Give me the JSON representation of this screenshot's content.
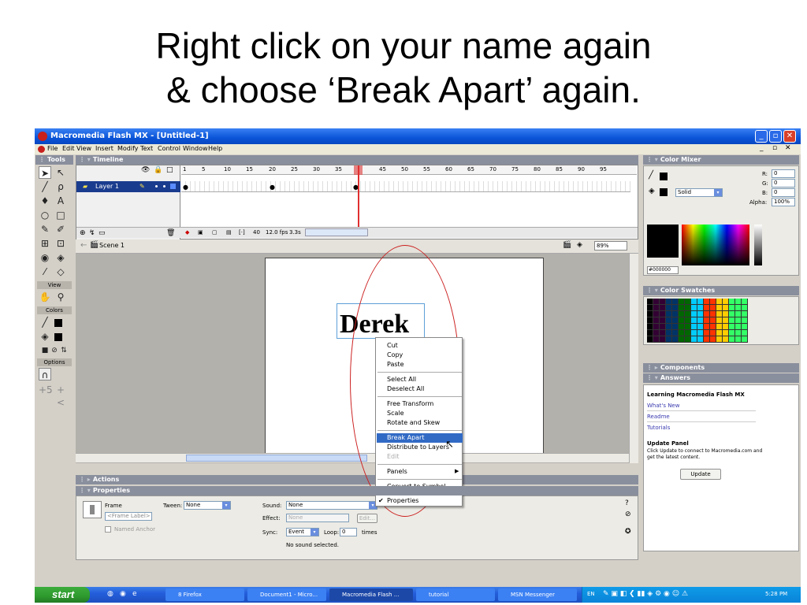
{
  "slide": {
    "title_line1": "Right click on your name again",
    "title_line2": "& choose ‘Break Apart’ again."
  },
  "window": {
    "title": "Macromedia Flash MX - [Untitled-1]",
    "minimize_icon": "minimize-icon",
    "maximize_icon": "maximize-icon",
    "close_icon": "close-icon"
  },
  "menubar": [
    "File",
    "Edit",
    "View",
    "Insert",
    "Modify",
    "Text",
    "Control",
    "Window",
    "Help"
  ],
  "tools_panel": {
    "header": "Tools",
    "view_label": "View",
    "colors_label": "Colors",
    "options_label": "Options"
  },
  "timeline": {
    "header": "Timeline",
    "layer_name": "Layer 1",
    "ruler": [
      "1",
      "5",
      "10",
      "15",
      "20",
      "25",
      "30",
      "35",
      "40",
      "45",
      "50",
      "55",
      "60",
      "65",
      "70",
      "75",
      "80",
      "85",
      "90",
      "95"
    ],
    "current_frame": "40",
    "frame_rate": "12.0 fps",
    "elapsed": "3.3s"
  },
  "scene": {
    "label": "Scene 1",
    "zoom": "89%"
  },
  "stage": {
    "text": "Derek"
  },
  "context_menu": {
    "items": [
      {
        "label": "Cut"
      },
      {
        "label": "Copy"
      },
      {
        "label": "Paste"
      },
      {
        "label": "Select All"
      },
      {
        "label": "Deselect All"
      },
      {
        "label": "Free Transform"
      },
      {
        "label": "Scale"
      },
      {
        "label": "Rotate and Skew"
      },
      {
        "label": "Break Apart"
      },
      {
        "label": "Distribute to Layers"
      },
      {
        "label": "Edit"
      },
      {
        "label": "Panels"
      },
      {
        "label": "Convert to Symbol..."
      },
      {
        "label": "Properties"
      }
    ],
    "highlighted": "Break Apart"
  },
  "actions_panel": {
    "header": "Actions"
  },
  "properties_panel": {
    "header": "Properties",
    "type_label": "Frame",
    "frame_label_placeholder": "<Frame Label>",
    "named_anchor": "Named Anchor",
    "tween_label": "Tween:",
    "tween_value": "None",
    "sound_label": "Sound:",
    "sound_value": "None",
    "effect_label": "Effect:",
    "effect_value": "None",
    "edit_button": "Edit...",
    "sync_label": "Sync:",
    "sync_value": "Event",
    "loop_label": "Loop:",
    "loop_value": "0",
    "times_label": "times",
    "status": "No sound selected."
  },
  "color_mixer": {
    "header": "Color Mixer",
    "r_label": "R:",
    "r_value": "0",
    "g_label": "G:",
    "g_value": "0",
    "b_label": "B:",
    "b_value": "0",
    "alpha_label": "Alpha:",
    "alpha_value": "100%",
    "fill_type": "Solid",
    "hex": "#000000"
  },
  "color_swatches": {
    "header": "Color Swatches"
  },
  "components": {
    "header": "Components"
  },
  "answers": {
    "header": "Answers",
    "title": "Learning Macromedia Flash MX",
    "links": [
      "What's New",
      "Readme",
      "Tutorials"
    ],
    "update_title": "Update Panel",
    "update_text": "Click Update to connect to Macromedia.com and get the latest content.",
    "update_button": "Update"
  },
  "taskbar": {
    "start": "start",
    "buttons": [
      {
        "label": "8 Firefox"
      },
      {
        "label": "Document1 - Micro..."
      },
      {
        "label": "Macromedia Flash ..."
      },
      {
        "label": "tutorial"
      },
      {
        "label": "MSN Messenger"
      }
    ],
    "language": "EN",
    "clock": "5:28 PM"
  },
  "colors": {
    "title_bar": "#0a55d8",
    "highlight": "#316ac5",
    "annotation_oval": "#cc2020",
    "stage_bg": "#b3b1ab"
  }
}
